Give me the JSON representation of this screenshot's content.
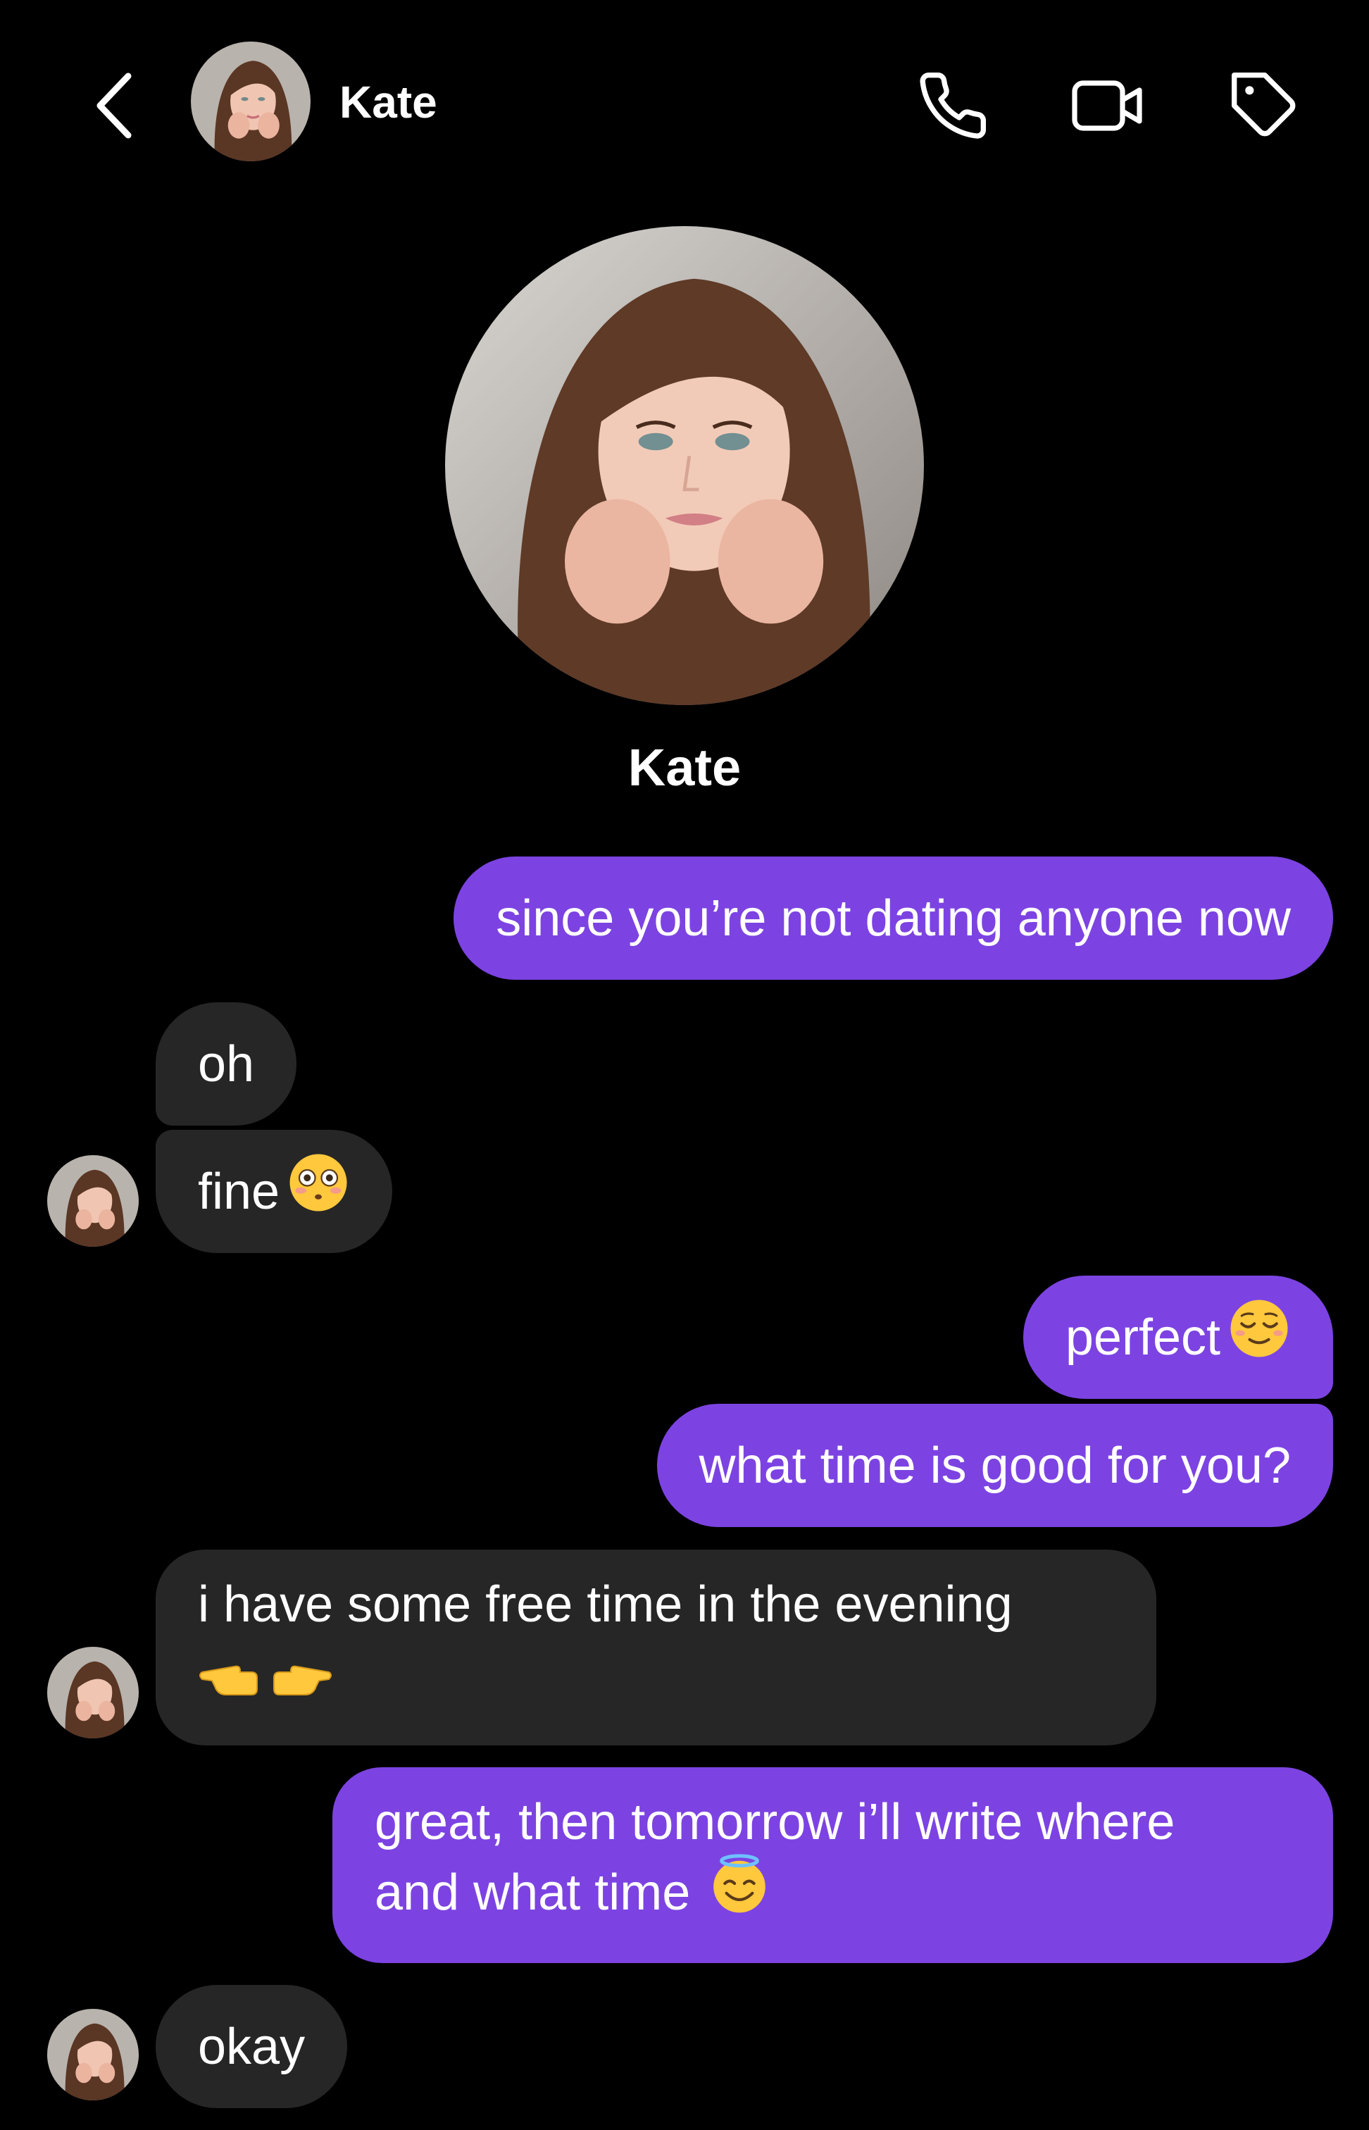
{
  "header": {
    "back_icon": "chevron-left-icon",
    "contact_name": "Kate",
    "call_icon": "phone-icon",
    "video_icon": "video-camera-icon",
    "tag_icon": "tag-icon"
  },
  "profile": {
    "name": "Kate"
  },
  "colors": {
    "background": "#000000",
    "sent_bubble": "#7c43e2",
    "received_bubble": "#262626",
    "text": "#ffffff"
  },
  "messages": [
    {
      "from": "me",
      "text": "since you’re not dating anyone now"
    },
    {
      "from": "kate",
      "text": "oh"
    },
    {
      "from": "kate",
      "text": "fine",
      "emoji": "flushed-face-emoji"
    },
    {
      "from": "me",
      "text": "perfect",
      "emoji": "relieved-face-emoji"
    },
    {
      "from": "me",
      "text": "what time is good for you?"
    },
    {
      "from": "kate",
      "text": "i have some free time in the evening",
      "emoji": "pointing-hands-emoji"
    },
    {
      "from": "me",
      "text_line1": "great, then tomorrow i’ll write where",
      "text_line2": "and what time",
      "emoji": "smiling-face-with-halo-emoji"
    },
    {
      "from": "kate",
      "text": "okay"
    }
  ]
}
